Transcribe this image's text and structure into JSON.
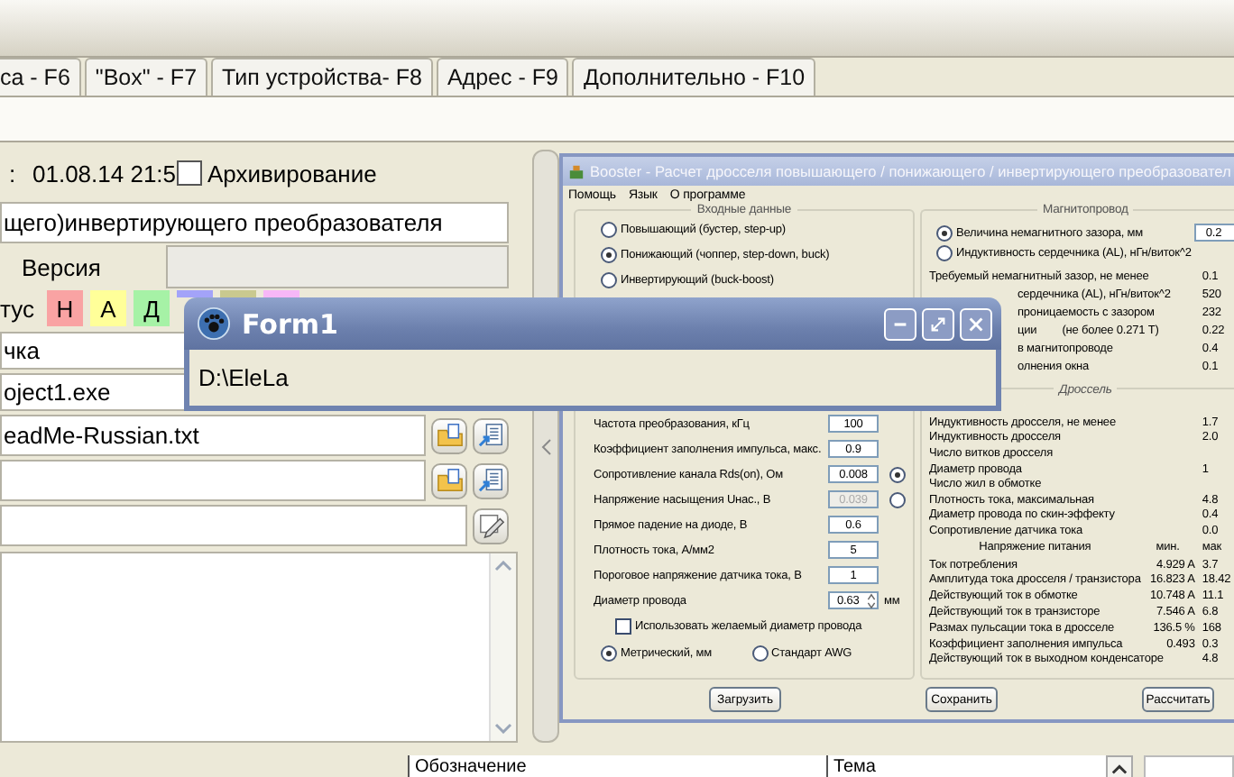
{
  "tabs": [
    {
      "label": "са - F6",
      "selected": false
    },
    {
      "label": "\"Box\" - F7",
      "selected": false
    },
    {
      "label": "Тип устройства- F8",
      "selected": false
    },
    {
      "label": "Адрес - F9",
      "selected": false
    },
    {
      "label": "Дополнительно - F10",
      "selected": false
    }
  ],
  "record": {
    "date_label": ":",
    "date": "01.08.14 21:5",
    "archive": {
      "label": "Архивирование",
      "checked": false
    },
    "name": "щего)инвертирующего преобразователя",
    "version_label": "Версия",
    "status_label": "тус",
    "status_buttons": [
      {
        "label": "Н",
        "color": "#f9a3a3"
      },
      {
        "label": "А",
        "color": "#ffff99"
      },
      {
        "label": "Д",
        "color": "#a6f2a6"
      },
      {
        "color": "#a3a3f9"
      },
      {
        "color": "#c9c98f"
      },
      {
        "color": "#f7b7f7"
      }
    ],
    "fields": [
      {
        "kind": "plain",
        "value": "чка"
      },
      {
        "kind": "plain",
        "value": "oject1.exe"
      },
      {
        "kind": "file",
        "value": "eadMe-Russian.txt"
      },
      {
        "kind": "file"
      },
      {
        "kind": "edit"
      }
    ]
  },
  "booster": {
    "title": "Booster - Расчет дросселя повышающего / понижающего / инвертирующего преобразовател",
    "menu": [
      "Помощь",
      "Язык",
      "О программе"
    ],
    "input": {
      "title": "Входные данные",
      "modes": [
        {
          "label": "Повышающий (бустер, step-up)",
          "selected": false
        },
        {
          "label": "Понижающий (чоппер, step-down, buck)",
          "selected": true
        },
        {
          "label": "Инвертирующий (buck-boost)",
          "selected": false
        }
      ],
      "params": [
        {
          "kind": "plain",
          "label": "Частота преобразования, кГц",
          "value": "100",
          "disabled": false
        },
        {
          "kind": "plain",
          "label": "Коэффициент заполнения импульса, макс.",
          "value": "0.9",
          "disabled": false
        },
        {
          "kind": "radio",
          "label": "Сопротивление канала Rds(on), Ом",
          "value": "0.008",
          "disabled": false,
          "selected": true
        },
        {
          "kind": "radio",
          "label": "Напряжение насыщения Uнас., В",
          "value": "0.039",
          "disabled": true,
          "selected": false
        },
        {
          "kind": "plain",
          "label": "Прямое падение на диоде, В",
          "value": "0.6",
          "disabled": false
        },
        {
          "kind": "plain",
          "label": "Плотность тока, А/мм2",
          "value": "5",
          "disabled": false
        },
        {
          "kind": "plain",
          "label": "Пороговое напряжение датчика тока, В",
          "value": "1",
          "disabled": false
        },
        {
          "kind": "spin",
          "label": "Диаметр провода",
          "value": "0.63",
          "disabled": false,
          "unit": "мм"
        }
      ],
      "checkbox": {
        "label": "Использовать желаемый диаметр провода",
        "checked": false
      },
      "units": [
        {
          "label": "Метрический, мм",
          "selected": true
        },
        {
          "label": "Стандарт AWG",
          "selected": false
        }
      ]
    },
    "magnetic": {
      "title": "Магнитопровод",
      "options": [
        {
          "label": "Величина немагнитного зазора, мм",
          "selected": true,
          "value": "0.2"
        },
        {
          "label": "Индуктивность сердечника (AL), нГн/виток^2",
          "selected": false
        }
      ],
      "rows": [
        {
          "kind": "full",
          "label": "Требуемый немагнитный зазор, не менее",
          "value": "0.1"
        },
        {
          "kind": "partial",
          "label": "сердечника (AL), нГн/виток^2",
          "value": "520"
        },
        {
          "kind": "partial",
          "label": "проницаемость с зазором",
          "value": "232"
        },
        {
          "kind": "partial",
          "label": "ции",
          "note": "(не более 0.271 Т)",
          "value": "0.22"
        },
        {
          "kind": "partial",
          "label": "в магнитопроводе",
          "value": "0.4"
        },
        {
          "kind": "partial",
          "label": "олнения окна",
          "value": "0.1"
        }
      ]
    },
    "choke": {
      "title": "Дроссель",
      "rows": [
        {
          "label": "Индуктивность дросселя, не менее",
          "value": "1.7"
        },
        {
          "label": "Индуктивность дросселя",
          "value": "2.0"
        },
        {
          "label": "Число витков дросселя"
        },
        {
          "label": "Диаметр провода",
          "value": "1"
        },
        {
          "label": "Число жил в обмотке"
        },
        {
          "label": "Плотность тока, максимальная",
          "value": "4.8"
        },
        {
          "label": "Диаметр провода по скин-эффекту",
          "value": "0.4"
        },
        {
          "label": "Сопротивление датчика тока",
          "value": "0.0"
        }
      ],
      "columns": [
        "Напряжение питания",
        "мин.",
        "мак"
      ],
      "table": [
        {
          "label": "Ток потребления",
          "min": "4.929 A",
          "max": "3.7"
        },
        {
          "label": "Амплитуда тока дросселя / транзистора",
          "min": "16.823 A",
          "max": "18.42"
        },
        {
          "label": "Действующий ток в обмотке",
          "min": "10.748 A",
          "max": "11.1"
        },
        {
          "label": "Действующий ток в транзисторе",
          "min": "7.546 A",
          "max": "6.8"
        },
        {
          "label": "Размах пульсации тока в дросселе",
          "min": "136.5 %",
          "max": "168"
        },
        {
          "label": "Коэффициент заполнения импульса",
          "min": "0.493",
          "max": "0.3"
        },
        {
          "label": "Действующий ток в выходном конденсаторе",
          "max": "4.8"
        }
      ]
    },
    "buttons": [
      "Загрузить",
      "Сохранить",
      "Рассчитать"
    ]
  },
  "form1": {
    "title": "Form1",
    "text": "D:\\EleLa"
  },
  "bottom_table": {
    "columns": [
      "Обозначение",
      "Тема"
    ]
  }
}
